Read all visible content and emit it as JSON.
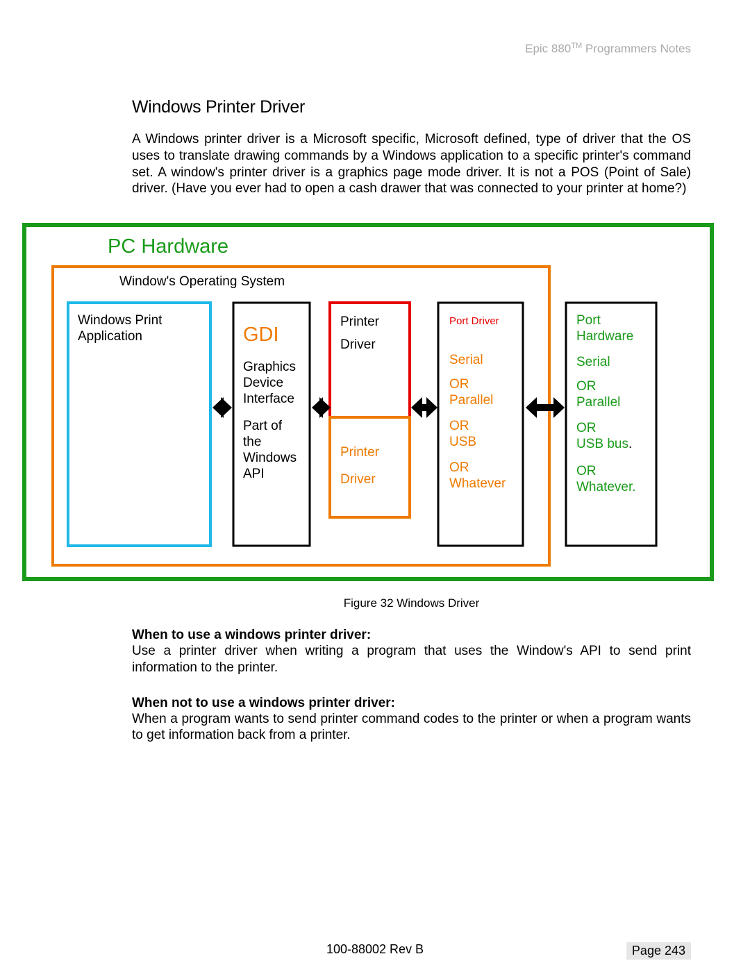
{
  "header": {
    "product": "Epic 880",
    "tm": "TM",
    "suffix": " Programmers Notes"
  },
  "title": "Windows Printer Driver",
  "paragraph1": "A Windows printer driver is a Microsoft specific, Microsoft defined, type of driver that the OS uses to translate drawing commands by a Windows application to a specific printer's command set.  A window's printer driver is a graphics page mode driver.  It is not a POS (Point of Sale) driver.  (Have you ever had to open a cash drawer that was connected to your printer at home?)",
  "diagram": {
    "pc_hardware": "PC Hardware",
    "winos": "Window's Operating System",
    "app": {
      "l1": "Windows Print",
      "l2": "Application"
    },
    "gdi": {
      "title": "GDI",
      "l1": "Graphics",
      "l2": "Device",
      "l3": "Interface",
      "l4": "Part of",
      "l5": "the",
      "l6": "Windows",
      "l7": "API"
    },
    "drv1": {
      "l1": "Printer",
      "l2": "Driver"
    },
    "drv2": {
      "l1": "Printer",
      "l2": "Driver"
    },
    "port_driver": {
      "title": "Port Driver",
      "l1": "Serial",
      "l2": "OR",
      "l3": "Parallel",
      "l4": "OR",
      "l5": "USB",
      "l6": "OR",
      "l7": "Whatever"
    },
    "port_hw": {
      "l1": "Port",
      "l2": "Hardware",
      "l3": "Serial",
      "l4": "OR",
      "l5": "Parallel",
      "l6": "OR",
      "l7": "USB bus",
      "dot": ".",
      "l8": "OR",
      "l9": "Whatever."
    }
  },
  "caption": "Figure 32 Windows Driver",
  "when_use_h": "When to use a windows printer driver:",
  "when_use_p": "Use a printer driver when writing a program that uses the Window's API to send print information to the printer.",
  "when_not_h": "When not to use a windows printer driver:",
  "when_not_p": "When a program wants to send printer command codes to the printer or when a program wants to get information back from a printer.",
  "footer": {
    "center": "100-88002 Rev B",
    "right": "Page 243"
  }
}
